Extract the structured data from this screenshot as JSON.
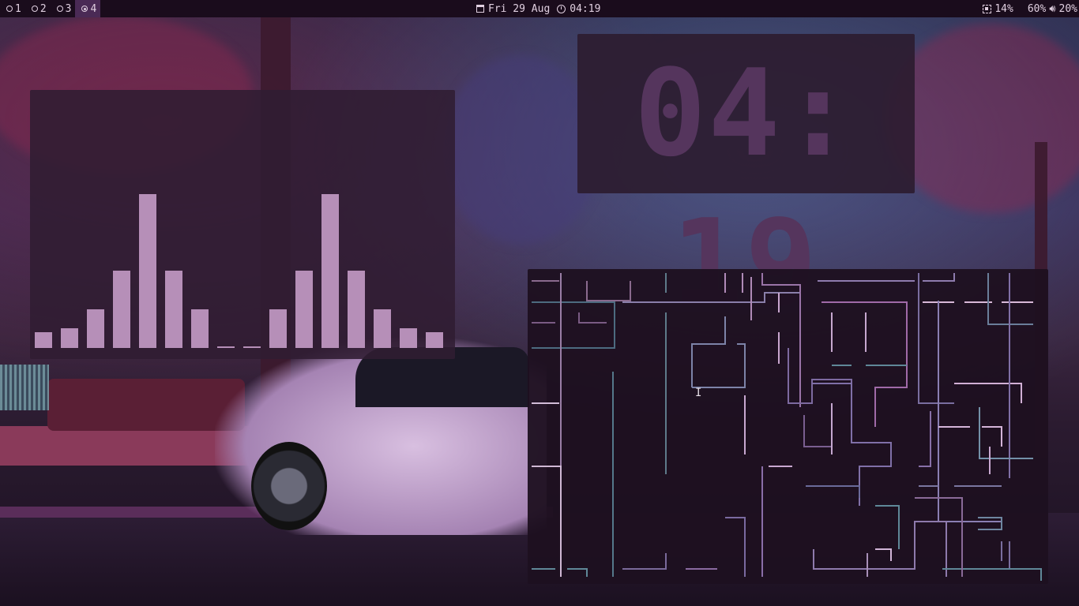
{
  "workspaces": [
    {
      "label": "1",
      "active": false
    },
    {
      "label": "2",
      "active": false
    },
    {
      "label": "3",
      "active": false
    },
    {
      "label": "4",
      "active": true
    }
  ],
  "statusbar": {
    "date": "Fri 29 Aug",
    "time": "04:19",
    "cpu": "14%",
    "memory": "60%",
    "volume": "20%"
  },
  "icons": {
    "calendar": "calendar-icon",
    "clock": "clock-icon",
    "cpu": "cpu-icon",
    "volume": "volume-icon",
    "cursor": "text-cursor-icon"
  },
  "big_clock": {
    "text": "04: 19"
  },
  "visualizer": {
    "levels": [
      0.1,
      0.13,
      0.25,
      0.5,
      1.0,
      0.5,
      0.25,
      0.01,
      0.01,
      0.25,
      0.5,
      1.0,
      0.5,
      0.25,
      0.13,
      0.1
    ]
  },
  "colors": {
    "bar_bg": "#1a0c1c",
    "accent": "#4a2a55",
    "visualizer_bar": "#b68fb8",
    "clock_digits": "#55355d"
  }
}
